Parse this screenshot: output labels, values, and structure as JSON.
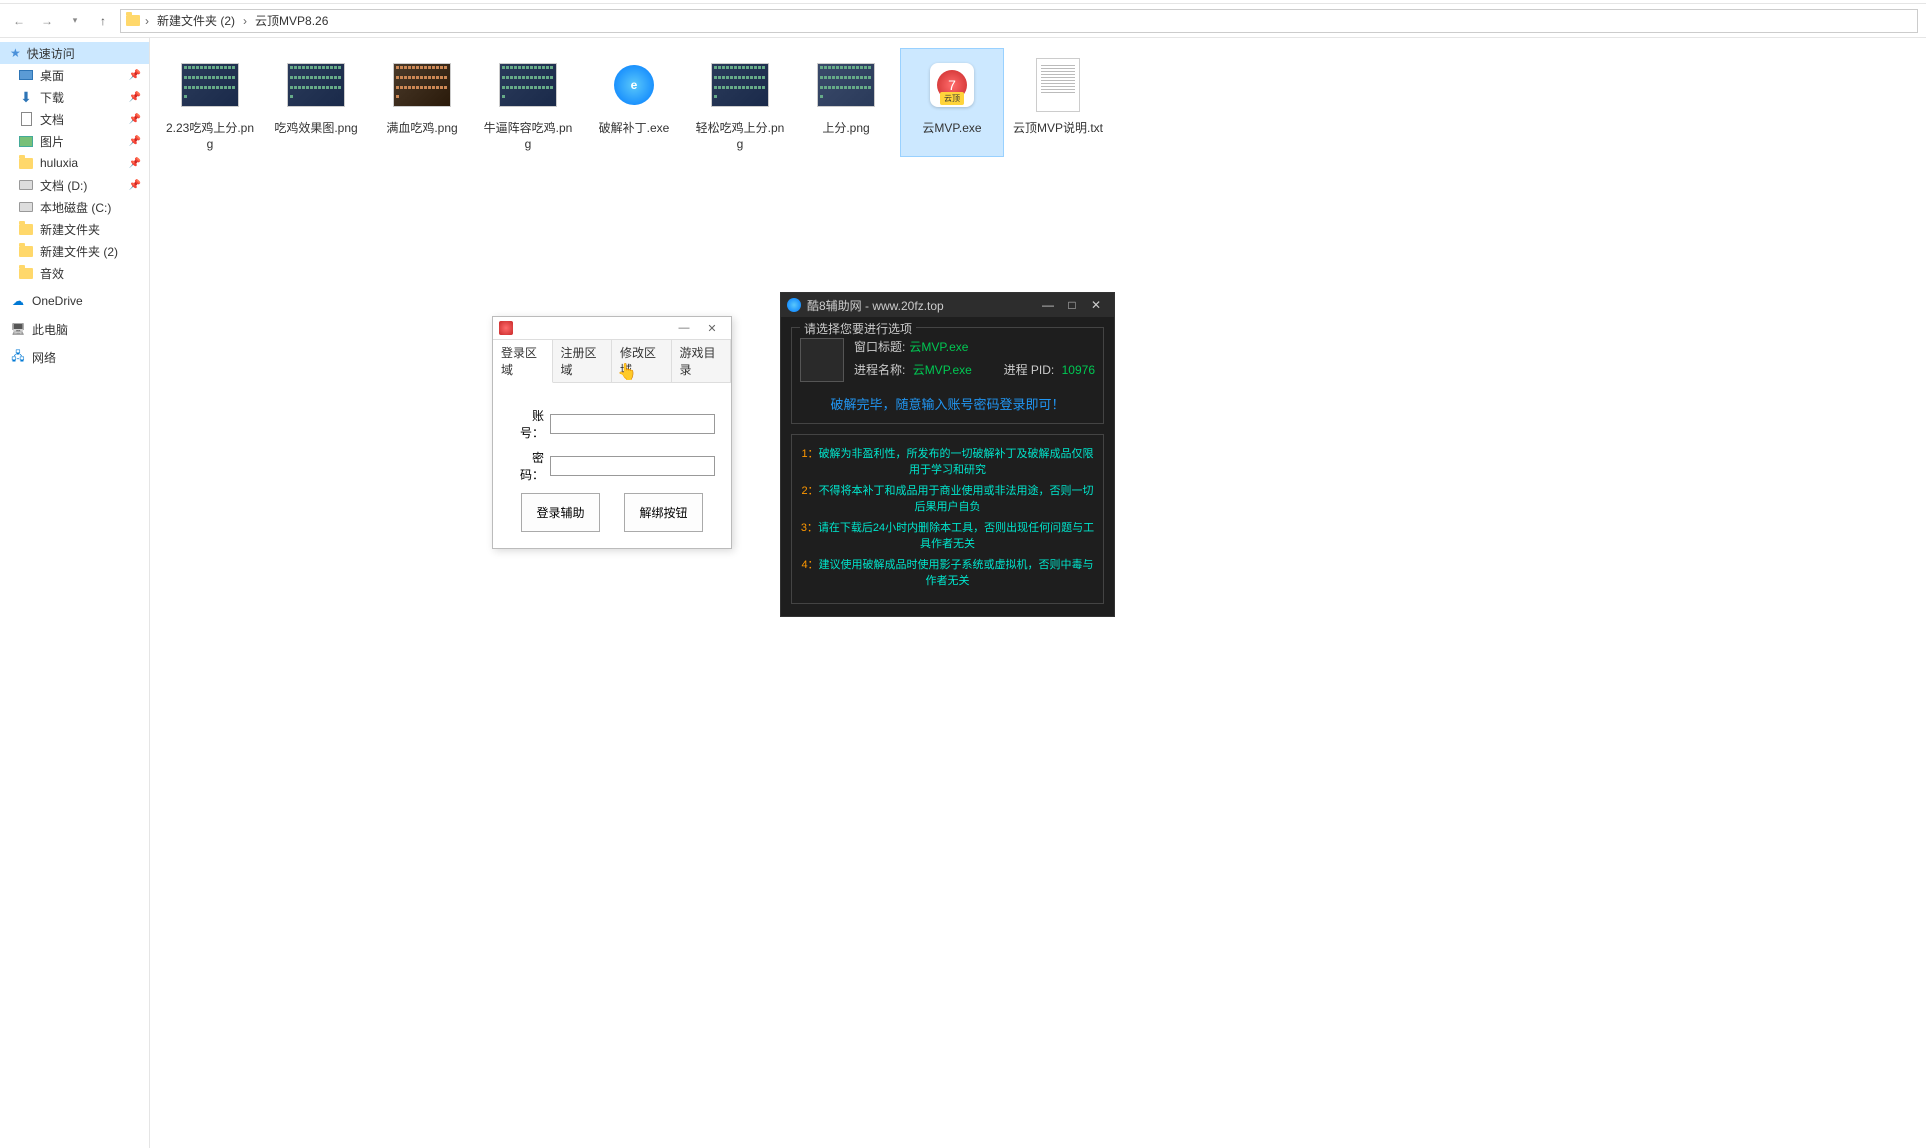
{
  "breadcrumb": {
    "segments": [
      "新建文件夹 (2)",
      "云顶MVP8.26"
    ]
  },
  "sidebar": {
    "quick": "快速访问",
    "items": [
      {
        "label": "桌面",
        "icon": "desktop",
        "pin": true
      },
      {
        "label": "下载",
        "icon": "download",
        "pin": true
      },
      {
        "label": "文档",
        "icon": "doc",
        "pin": true
      },
      {
        "label": "图片",
        "icon": "img",
        "pin": true
      },
      {
        "label": "huluxia",
        "icon": "folder",
        "pin": true
      },
      {
        "label": "文档 (D:)",
        "icon": "drive",
        "pin": true
      },
      {
        "label": "本地磁盘 (C:)",
        "icon": "drive",
        "pin": false
      },
      {
        "label": "新建文件夹",
        "icon": "folder",
        "pin": false
      },
      {
        "label": "新建文件夹 (2)",
        "icon": "folder",
        "pin": false
      },
      {
        "label": "音效",
        "icon": "folder",
        "pin": false
      }
    ],
    "onedrive": "OneDrive",
    "thispc": "此电脑",
    "network": "网络"
  },
  "files": [
    {
      "name": "2.23吃鸡上分.png",
      "type": "img",
      "variant": "dark"
    },
    {
      "name": "吃鸡效果图.png",
      "type": "img",
      "variant": "dark"
    },
    {
      "name": "满血吃鸡.png",
      "type": "img",
      "variant": "orange"
    },
    {
      "name": "牛逼阵容吃鸡.png",
      "type": "img",
      "variant": "dark"
    },
    {
      "name": "破解补丁.exe",
      "type": "exe",
      "variant": "patch"
    },
    {
      "name": "轻松吃鸡上分.png",
      "type": "img",
      "variant": "dark"
    },
    {
      "name": "上分.png",
      "type": "img",
      "variant": "game"
    },
    {
      "name": "云MVP.exe",
      "type": "exe",
      "variant": "mvp",
      "selected": true
    },
    {
      "name": "云顶MVP说明.txt",
      "type": "txt"
    }
  ],
  "mvp_tag": "云顶",
  "login": {
    "tabs": [
      "登录区域",
      "注册区域",
      "修改区域",
      "游戏目录"
    ],
    "account_label": "账号：",
    "password_label": "密码：",
    "login_btn": "登录辅助",
    "unbind_btn": "解绑按钮"
  },
  "crack": {
    "title": "酷8辅助网 - www.20fz.top",
    "fieldset_title": "请选择您要进行选项",
    "window_title_label": "窗口标题:",
    "window_title_value": "云MVP.exe",
    "process_name_label": "进程名称:",
    "process_name_value": "云MVP.exe",
    "pid_label": "进程 PID:",
    "pid_value": "10976",
    "status": "破解完毕，随意输入账号密码登录即可！",
    "rules": [
      {
        "num": "1：",
        "txt": "破解为非盈利性，所发布的一切破解补丁及破解成品仅限用于学习和研究"
      },
      {
        "num": "2：",
        "txt": "不得将本补丁和成品用于商业使用或非法用途，否则一切后果用户自负"
      },
      {
        "num": "3：",
        "txt": "请在下载后24小时内删除本工具，否则出现任何问题与工具作者无关"
      },
      {
        "num": "4：",
        "txt": "建议使用破解成品时使用影子系统或虚拟机，否则中毒与作者无关"
      }
    ]
  }
}
